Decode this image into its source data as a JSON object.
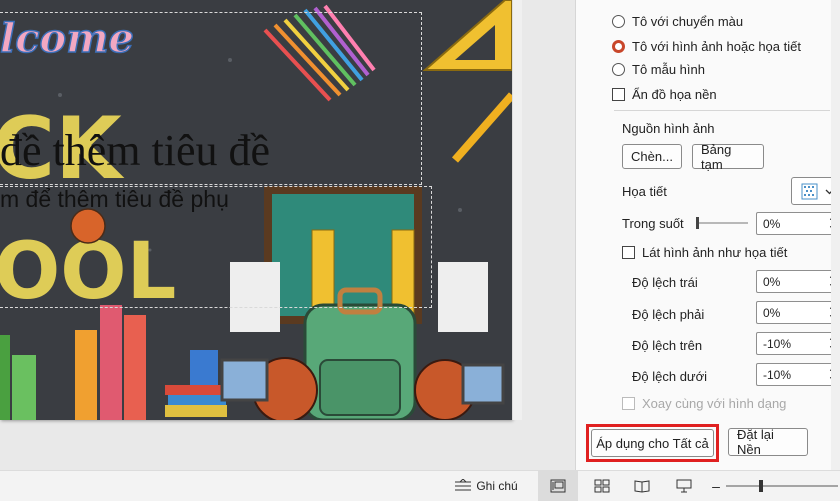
{
  "slide": {
    "title_text": "đề thêm tiêu đề",
    "subtitle_text": "m để thêm tiêu đề phụ",
    "art_words": [
      "lcome",
      "CK",
      "OOL"
    ]
  },
  "format_pane": {
    "fill_options": [
      {
        "label": "Tô với chuyển màu",
        "selected": false
      },
      {
        "label": "Tô với hình ảnh hoặc họa tiết",
        "selected": true
      },
      {
        "label": "Tô mẫu hình",
        "selected": false
      }
    ],
    "hide_background_label": "Ẩn đồ họa nền",
    "image_source_label": "Nguồn hình ảnh",
    "insert_button": "Chèn...",
    "clipboard_button": "Bảng tạm",
    "texture_label": "Họa tiết",
    "transparency_label": "Trong suốt",
    "transparency_value": "0%",
    "tile_label": "Lát hình ảnh như họa tiết",
    "offsets": [
      {
        "label": "Độ lệch trái",
        "value": "0%"
      },
      {
        "label": "Độ lệch phải",
        "value": "0%"
      },
      {
        "label": "Độ lệch trên",
        "value": "-10%"
      },
      {
        "label": "Độ lệch dưới",
        "value": "-10%"
      }
    ],
    "rotate_label": "Xoay cùng với hình dạng",
    "apply_all_button": "Áp dụng cho Tất cả",
    "reset_button": "Đặt lại Nền"
  },
  "statusbar": {
    "notes_label": "Ghi chú"
  },
  "colors": {
    "accent": "#c8462a",
    "highlight": "#e02020",
    "chalkboard": "#3a3d42"
  }
}
